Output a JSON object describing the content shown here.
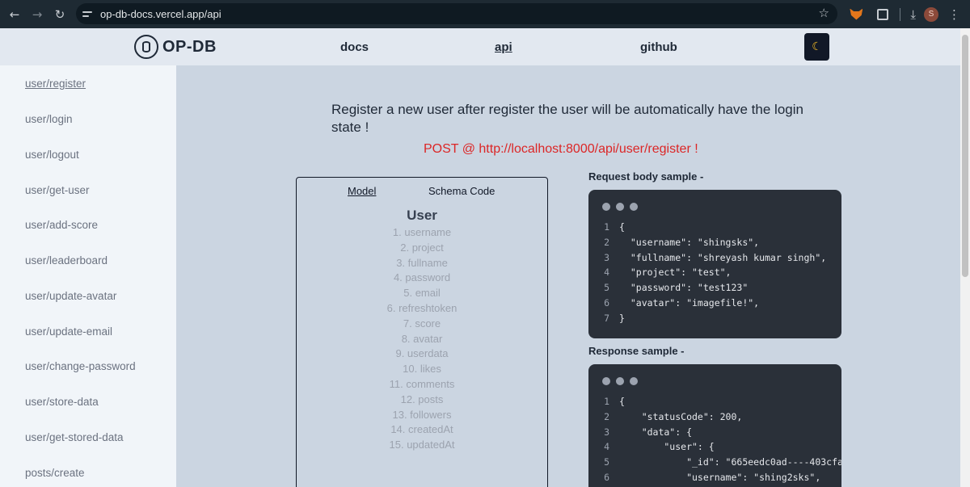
{
  "browser": {
    "url": "op-db-docs.vercel.app/api",
    "profile_initial": "S",
    "icons": [
      "back-arrow-icon",
      "forward-arrow-icon",
      "reload-icon",
      "site-settings-icon",
      "bookmark-star-icon",
      "metamask-icon",
      "extensions-icon",
      "download-icon",
      "menu-icon"
    ]
  },
  "header": {
    "logo_text": "OP-DB",
    "nav": [
      {
        "label": "docs"
      },
      {
        "label": "api"
      },
      {
        "label": "github"
      }
    ],
    "theme_icon": "moon-icon"
  },
  "sidebar": {
    "items": [
      {
        "label": "user/register"
      },
      {
        "label": "user/login"
      },
      {
        "label": "user/logout"
      },
      {
        "label": "user/get-user"
      },
      {
        "label": "user/add-score"
      },
      {
        "label": "user/leaderboard"
      },
      {
        "label": "user/update-avatar"
      },
      {
        "label": "user/update-email"
      },
      {
        "label": "user/change-password"
      },
      {
        "label": "user/store-data"
      },
      {
        "label": "user/get-stored-data"
      },
      {
        "label": "posts/create"
      }
    ]
  },
  "main": {
    "description": "Register a new user after register the user will be automatically have the login state !",
    "endpoint": "POST @ http://localhost:8000/api/user/register !",
    "model_tabs": [
      {
        "label": "Model"
      },
      {
        "label": "Schema Code"
      }
    ],
    "model_title": "User",
    "fields": [
      "1. username",
      "2. project",
      "3. fullname",
      "4. password",
      "5. email",
      "6. refreshtoken",
      "7. score",
      "8. avatar",
      "9. userdata",
      "10. likes",
      "11. comments",
      "12. posts",
      "13. followers",
      "14. createdAt",
      "15. updatedAt"
    ],
    "request": {
      "title": "Request body sample -",
      "lines": [
        {
          "n": "1",
          "t": "{"
        },
        {
          "n": "2",
          "t": "  \"username\": \"shingsks\","
        },
        {
          "n": "3",
          "t": "  \"fullname\": \"shreyash kumar singh\","
        },
        {
          "n": "4",
          "t": "  \"project\": \"test\","
        },
        {
          "n": "5",
          "t": "  \"password\": \"test123\""
        },
        {
          "n": "6",
          "t": "  \"avatar\": \"imagefile!\","
        },
        {
          "n": "7",
          "t": "}"
        }
      ]
    },
    "response": {
      "title": "Response sample -",
      "lines": [
        {
          "n": "1",
          "t": "{"
        },
        {
          "n": "2",
          "t": "    \"statusCode\": 200,"
        },
        {
          "n": "3",
          "t": "    \"data\": {"
        },
        {
          "n": "4",
          "t": "        \"user\": {"
        },
        {
          "n": "5",
          "t": "            \"_id\": \"665eedc0ad----403cfa"
        },
        {
          "n": "6",
          "t": "            \"username\": \"shing2sks\","
        }
      ]
    }
  }
}
